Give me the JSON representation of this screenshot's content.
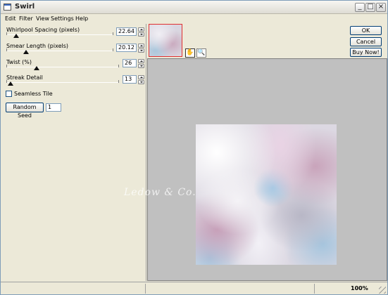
{
  "window": {
    "title": "Swirl"
  },
  "menu": [
    "Edit",
    "Filter",
    "View",
    "Settings",
    "Help"
  ],
  "params": [
    {
      "label": "Whirlpool Spacing (pixels)",
      "value": "22.64"
    },
    {
      "label": "Smear Length (pixels)",
      "value": "20.12"
    },
    {
      "label": "Twist (%)",
      "value": "26"
    },
    {
      "label": "Streak Detail",
      "value": "13"
    }
  ],
  "seamless": {
    "label": "Seamless Tile",
    "checked": false
  },
  "random_seed": {
    "button_label": "Random Seed",
    "value": "1"
  },
  "buttons": {
    "ok": "OK",
    "cancel": "Cancel",
    "buy": "Buy Now!"
  },
  "tools": [
    "hand-icon",
    "magnifier-icon"
  ],
  "watermark": "Ledow & Co.",
  "status": {
    "zoom": "100%"
  },
  "colors": {
    "preview_border": "#e03030",
    "preview_bg": "#c0c0c0"
  }
}
